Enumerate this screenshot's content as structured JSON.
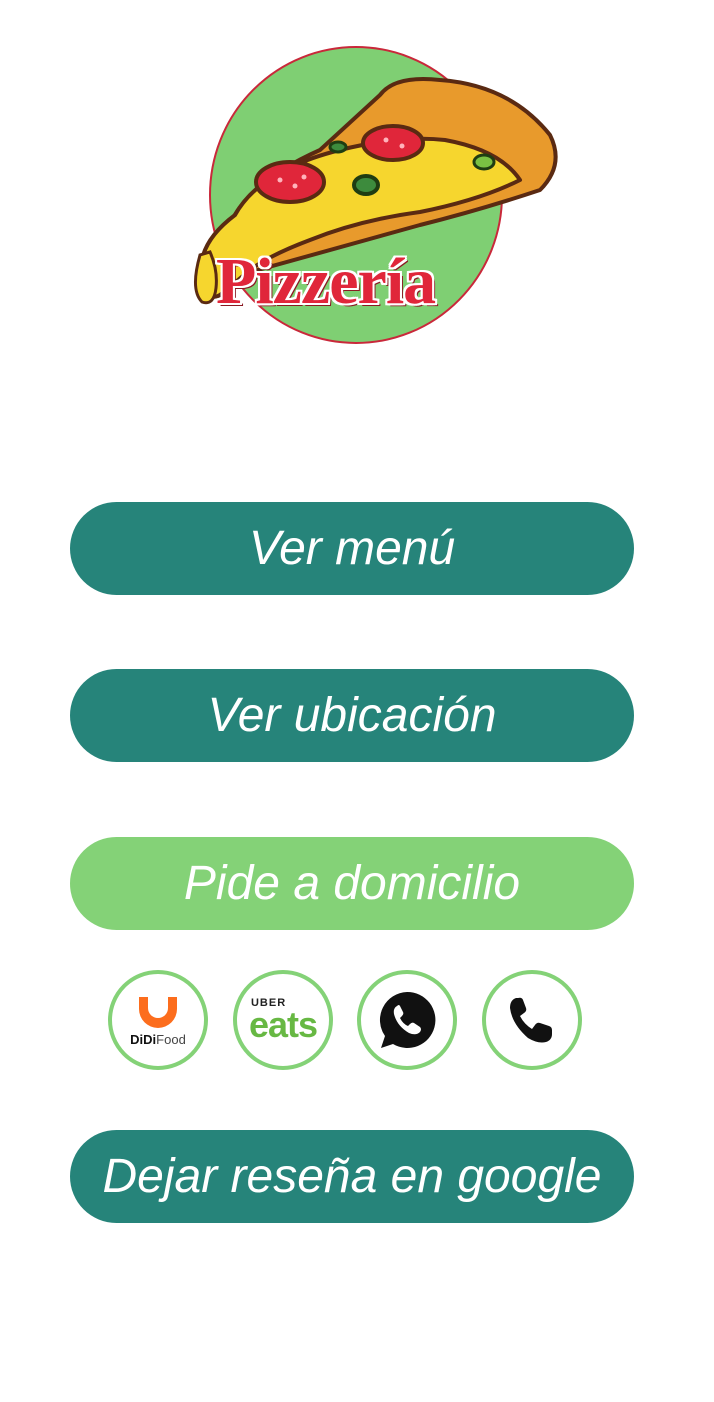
{
  "logo": {
    "text": "Pizzería",
    "alt": "pizza-logo"
  },
  "buttons": {
    "menu": "Ver menú",
    "location": "Ver ubicación",
    "delivery": "Pide a domicilio",
    "review": "Dejar reseña en google"
  },
  "delivery_apps": {
    "didi": {
      "brand": "DiDi",
      "suffix": "Food"
    },
    "uber": {
      "top": "UBER",
      "bottom": "eats"
    },
    "whatsapp": {
      "icon": "whatsapp-icon"
    },
    "phone": {
      "icon": "phone-icon"
    }
  },
  "colors": {
    "teal": "#26847a",
    "green": "#84d277",
    "logo_red": "#e0263a",
    "didi_orange": "#fc6d1d",
    "uber_green": "#67b843"
  }
}
